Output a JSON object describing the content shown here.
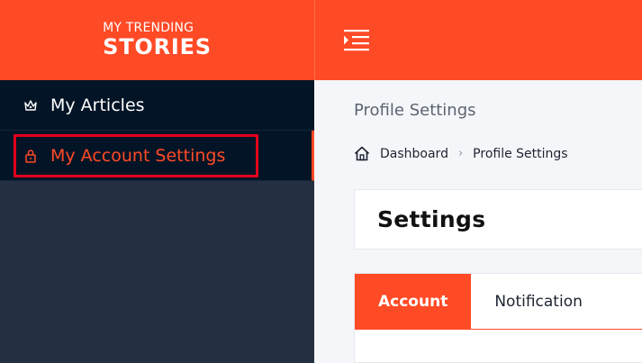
{
  "brand": {
    "line1": "MY TRENDING",
    "line2": "STORIES"
  },
  "sidebar": {
    "items": [
      {
        "label": "My Articles",
        "icon": "crown-icon"
      },
      {
        "label": "My Account Settings",
        "icon": "lock-icon"
      }
    ]
  },
  "header": {
    "menu_icon": "menu-toggle-icon"
  },
  "main": {
    "page_title": "Profile Settings",
    "breadcrumb": {
      "home": "Dashboard",
      "current": "Profile Settings"
    },
    "card_title": "Settings",
    "tabs": [
      {
        "label": "Account"
      },
      {
        "label": "Notification"
      }
    ]
  },
  "colors": {
    "accent": "#ff4a26",
    "sidebar_dark": "#031426",
    "sidebar_body": "#243041",
    "highlight": "#e3001b"
  }
}
